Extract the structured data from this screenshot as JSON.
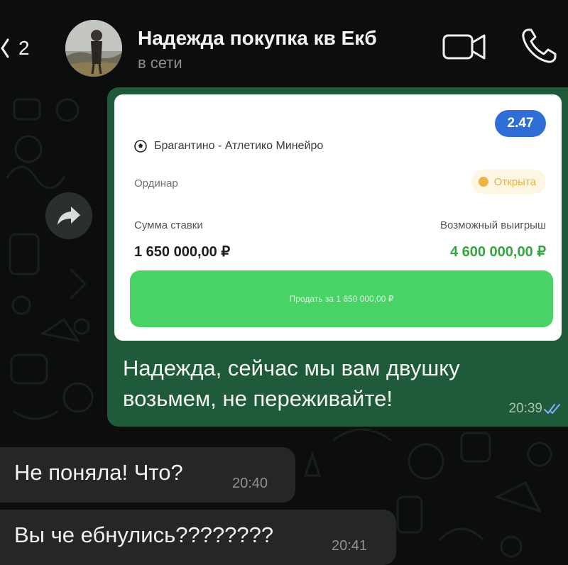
{
  "header": {
    "back_count": "2",
    "contact_name": "Надежда покупка кв Екб",
    "status": "в сети"
  },
  "bet_card": {
    "odds": "2.47",
    "match": "Брагантино - Атлетико Минейро",
    "bet_type": "Ординар",
    "status": "Открыта",
    "stake_label": "Сумма ставки",
    "stake_value": "1 650 000,00 ₽",
    "payout_label": "Возможный выигрыш",
    "payout_value": "4 600 000,00 ₽",
    "sell_button": "Продать за 1 650 000,00 ₽"
  },
  "messages": {
    "outgoing": {
      "text": "Надежда, сейчас мы вам двушку возьмем, не переживайте!",
      "time": "20:39"
    },
    "incoming": [
      {
        "text": "Не поняла! Что?",
        "time": "20:40"
      },
      {
        "text": "Вы че ебнулись????????",
        "time": "20:41"
      }
    ]
  },
  "colors": {
    "outgoing_bubble": "#1f5a3a",
    "incoming_bubble": "#252725",
    "odds_badge": "#2e6ed6",
    "sell_button": "#49d266",
    "payout": "#35a540"
  },
  "icons": [
    "chevron-left-icon",
    "video-call-icon",
    "phone-icon",
    "forward-icon",
    "soccer-ball-icon",
    "double-check-icon"
  ]
}
